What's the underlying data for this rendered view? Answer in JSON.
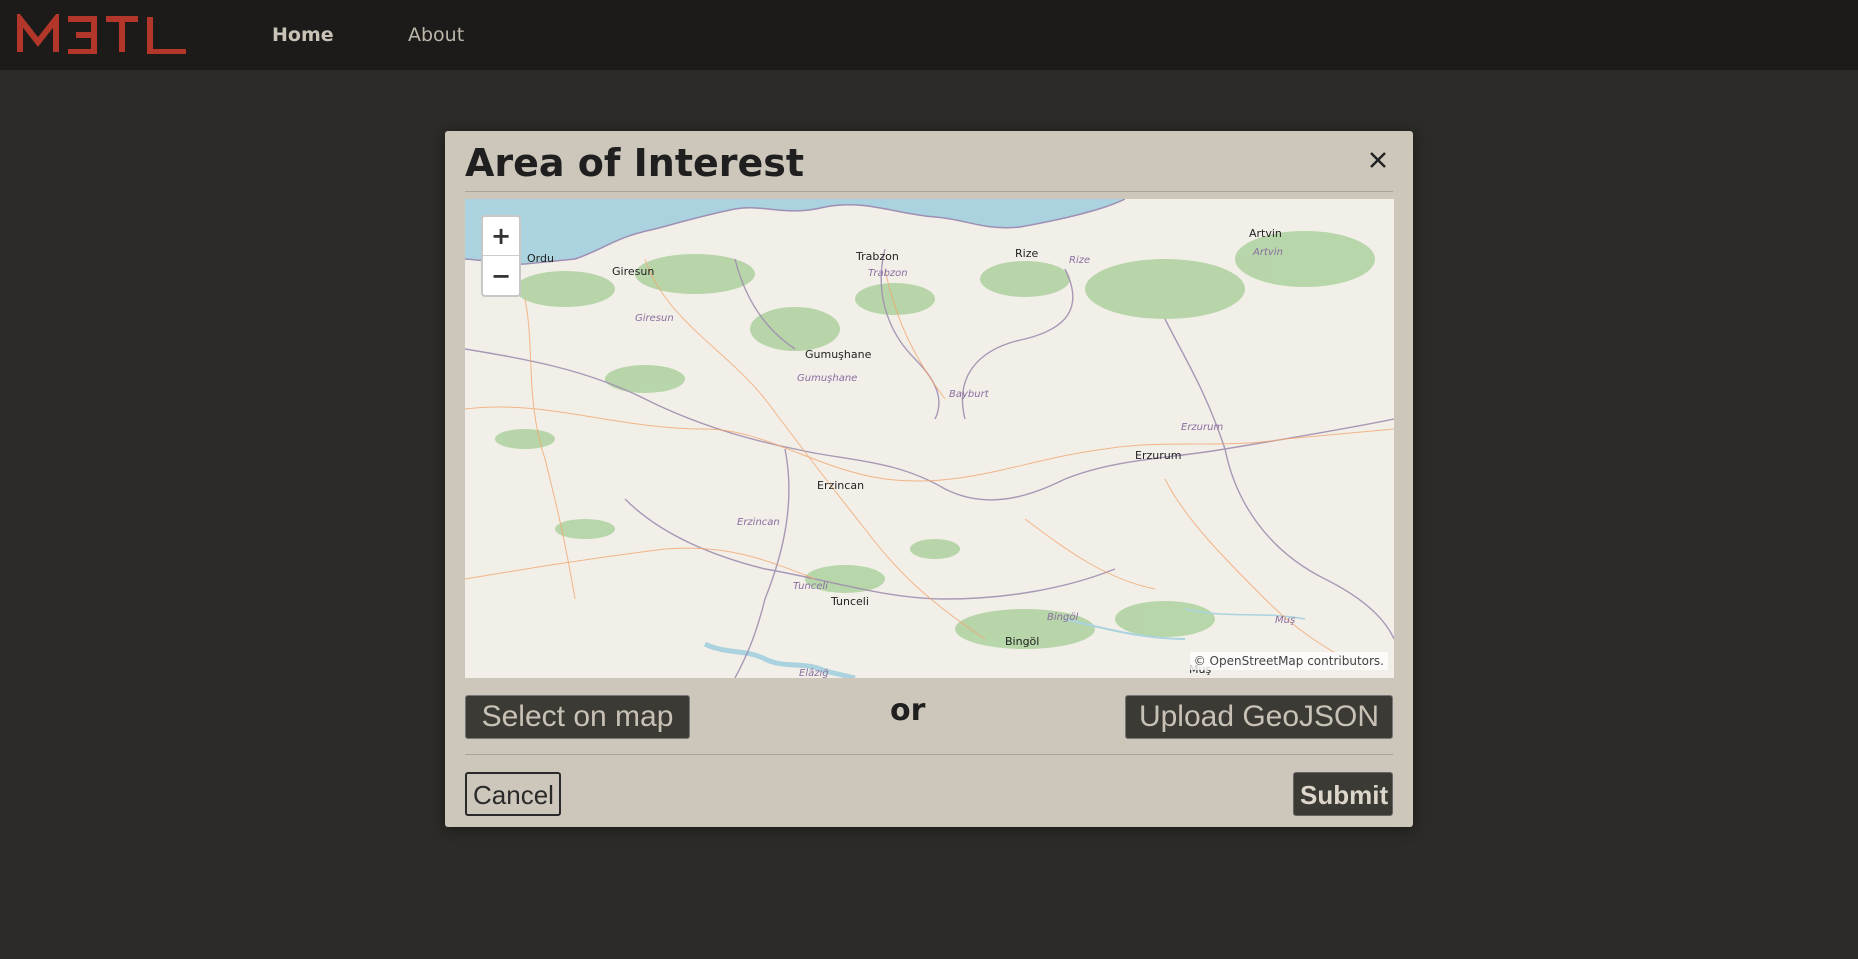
{
  "app": {
    "logo_text": "M3TL",
    "brand_color": "#b2372a"
  },
  "nav": {
    "home_label": "Home",
    "about_label": "About"
  },
  "modal": {
    "title": "Area of Interest",
    "close_icon": "close-icon",
    "or_text": "or",
    "select_label": "Select on map",
    "upload_label": "Upload GeoJSON",
    "cancel_label": "Cancel",
    "submit_label": "Submit"
  },
  "map": {
    "zoom_in": "+",
    "zoom_out": "−",
    "attribution": "© OpenStreetMap contributors.",
    "places": {
      "ordu": "Ordu",
      "giresun": "Giresun",
      "giresun_prov": "Giresun",
      "trabzon": "Trabzon",
      "trabzon_prov": "Trabzon",
      "rize": "Rize",
      "rize_prov": "Rize",
      "artvin": "Artvin",
      "artvin_prov": "Artvin",
      "gumushane": "Gumuşhane",
      "gumushane_prov": "Gumuşhane",
      "bayburt": "Bayburt",
      "erzurum": "Erzurum",
      "erzurum_prov": "Erzurum",
      "erzincan": "Erzincan",
      "erzincan_prov": "Erzincan",
      "tunceli": "Tunceli",
      "tunceli_prov": "Tunceli",
      "bingol": "Bingöl",
      "bingol_prov": "Bingöl",
      "mus_prov": "Muş",
      "mus": "Muş",
      "elazig": "Elâzığ"
    }
  }
}
